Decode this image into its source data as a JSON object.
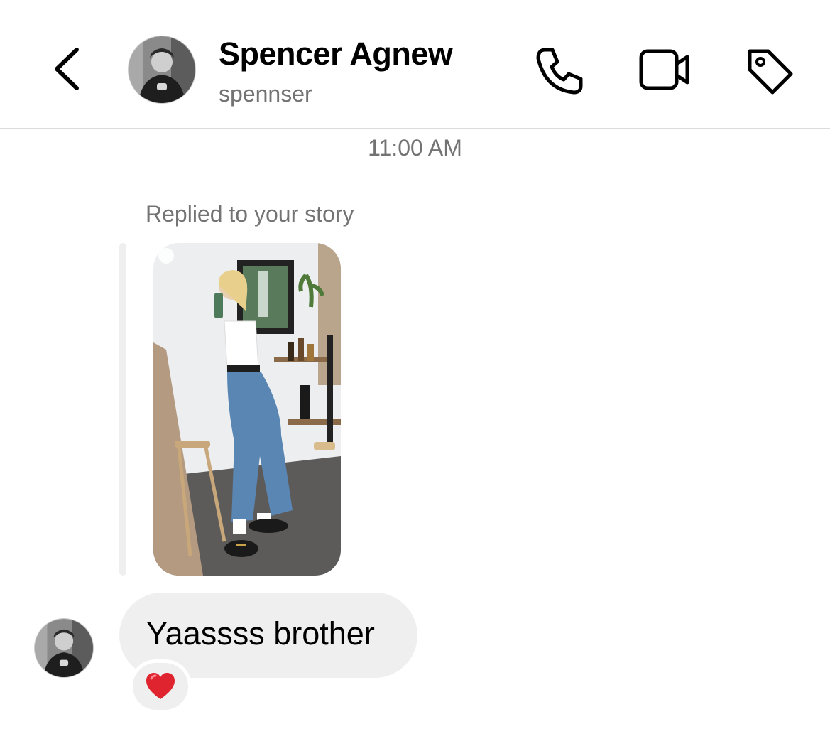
{
  "header": {
    "contact_name": "Spencer Agnew",
    "username": "spennser",
    "icons": {
      "back": "chevron-left-icon",
      "call": "phone-icon",
      "video": "video-camera-icon",
      "tag": "tag-icon"
    }
  },
  "thread": {
    "timestamp": "11:00 AM",
    "story_reply_label": "Replied to your story",
    "message": {
      "text": "Yaassss brother",
      "reaction": "heart"
    }
  },
  "colors": {
    "secondary_text": "#737373",
    "bubble_bg": "#efefef",
    "divider": "#dbdbdb",
    "reaction_heart": "#e0242f"
  }
}
